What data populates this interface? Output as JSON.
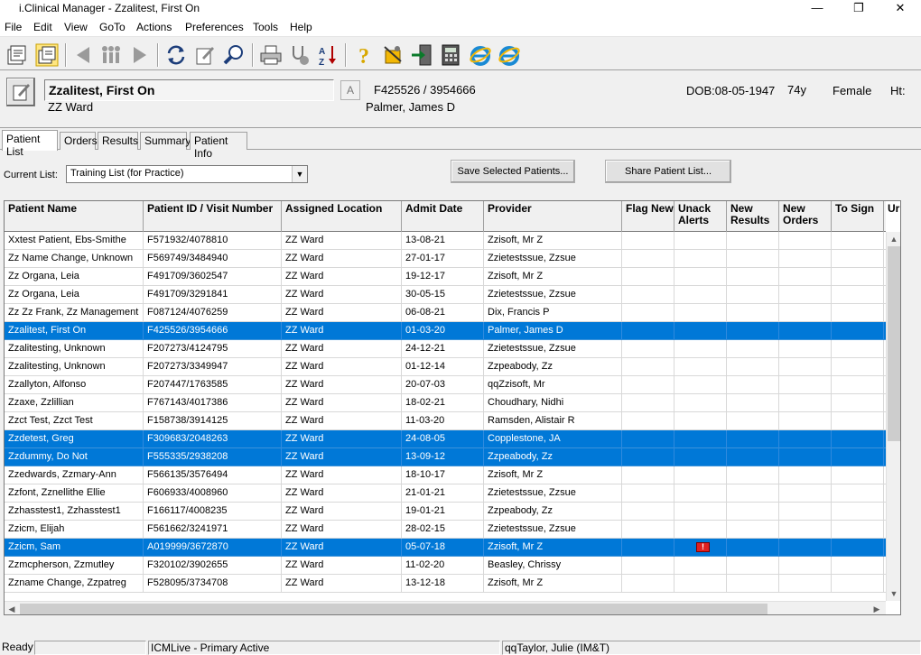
{
  "window": {
    "title": "i.Clinical Manager - Zzalitest, First On",
    "min_glyph": "—",
    "max_glyph": "❐",
    "close_glyph": "✕"
  },
  "menu": [
    "File",
    "Edit",
    "View",
    "GoTo",
    "Actions",
    "Preferences",
    "Tools",
    "Help"
  ],
  "toolbar_icons": [
    "patient-list-icon",
    "patient-list-edit-icon",
    "back-arrow-icon",
    "people-icon",
    "forward-arrow-icon",
    "refresh-icon",
    "notes-icon",
    "search-icon",
    "print-icon",
    "stethoscope-icon",
    "sort-az-icon",
    "help-icon",
    "tools-icon",
    "exit-icon",
    "calculator-icon",
    "internet-explorer-icon",
    "internet-explorer-icon-2"
  ],
  "patient": {
    "name": "Zzalitest, First On",
    "a_label": "A",
    "ids": "F425526 / 3954666",
    "ward": "ZZ Ward",
    "provider": "Palmer, James D",
    "dob": "DOB:08-05-1947",
    "age": "74y",
    "sex": "Female",
    "ht": "Ht:"
  },
  "tabs": [
    "Patient List",
    "Orders",
    "Results",
    "Summary",
    "Patient Info"
  ],
  "current_list": {
    "label": "Current List:",
    "value": "Training List (for Practice)"
  },
  "buttons": {
    "save_selected": "Save Selected Patients...",
    "share_list": "Share Patient List..."
  },
  "columns": [
    "Patient Name",
    "Patient ID / Visit Number",
    "Assigned Location",
    "Admit Date",
    "Provider",
    "Flag New",
    "Unack Alerts",
    "New Results",
    "New Orders",
    "To Sign",
    "Ur"
  ],
  "rows": [
    {
      "name": "Xxtest Patient, Ebs-Smithe",
      "id": "F571932/4078810",
      "loc": "ZZ Ward",
      "admit": "13-08-21",
      "provider": "Zzisoft, Mr Z",
      "selected": false
    },
    {
      "name": "Zz Name Change, Unknown",
      "id": "F569749/3484940",
      "loc": "ZZ Ward",
      "admit": "27-01-17",
      "provider": "Zzietestssue, Zzsue",
      "selected": false
    },
    {
      "name": "Zz Organa, Leia",
      "id": "F491709/3602547",
      "loc": "ZZ Ward",
      "admit": "19-12-17",
      "provider": "Zzisoft, Mr Z",
      "selected": false
    },
    {
      "name": "Zz Organa, Leia",
      "id": "F491709/3291841",
      "loc": "ZZ Ward",
      "admit": "30-05-15",
      "provider": "Zzietestssue, Zzsue",
      "selected": false
    },
    {
      "name": "Zz Zz Frank, Zz Management",
      "id": "F087124/4076259",
      "loc": "ZZ Ward",
      "admit": "06-08-21",
      "provider": "Dix, Francis P",
      "selected": false
    },
    {
      "name": "Zzalitest, First On",
      "id": "F425526/3954666",
      "loc": "ZZ Ward",
      "admit": "01-03-20",
      "provider": "Palmer, James D",
      "selected": true
    },
    {
      "name": "Zzalitesting, Unknown",
      "id": "F207273/4124795",
      "loc": "ZZ Ward",
      "admit": "24-12-21",
      "provider": "Zzietestssue, Zzsue",
      "selected": false
    },
    {
      "name": "Zzalitesting, Unknown",
      "id": "F207273/3349947",
      "loc": "ZZ Ward",
      "admit": "01-12-14",
      "provider": "Zzpeabody, Zz",
      "selected": false
    },
    {
      "name": "Zzallyton, Alfonso",
      "id": "F207447/1763585",
      "loc": "ZZ Ward",
      "admit": "20-07-03",
      "provider": "qqZzisoft, Mr",
      "selected": false
    },
    {
      "name": "Zzaxe, Zzlillian",
      "id": "F767143/4017386",
      "loc": "ZZ Ward",
      "admit": "18-02-21",
      "provider": "Choudhary, Nidhi",
      "selected": false
    },
    {
      "name": "Zzct Test, Zzct Test",
      "id": "F158738/3914125",
      "loc": "ZZ Ward",
      "admit": "11-03-20",
      "provider": "Ramsden, Alistair R",
      "selected": false
    },
    {
      "name": "Zzdetest, Greg",
      "id": "F309683/2048263",
      "loc": "ZZ Ward",
      "admit": "24-08-05",
      "provider": "Copplestone, JA",
      "selected": true
    },
    {
      "name": "Zzdummy, Do Not",
      "id": "F555335/2938208",
      "loc": "ZZ Ward",
      "admit": "13-09-12",
      "provider": "Zzpeabody, Zz",
      "selected": true
    },
    {
      "name": "Zzedwards, Zzmary-Ann",
      "id": "F566135/3576494",
      "loc": "ZZ Ward",
      "admit": "18-10-17",
      "provider": "Zzisoft, Mr Z",
      "selected": false
    },
    {
      "name": "Zzfont, Zznellithe Ellie",
      "id": "F606933/4008960",
      "loc": "ZZ Ward",
      "admit": "21-01-21",
      "provider": "Zzietestssue, Zzsue",
      "selected": false
    },
    {
      "name": "Zzhasstest1, Zzhasstest1",
      "id": "F166117/4008235",
      "loc": "ZZ Ward",
      "admit": "19-01-21",
      "provider": "Zzpeabody, Zz",
      "selected": false
    },
    {
      "name": "Zzicm, Elijah",
      "id": "F561662/3241971",
      "loc": "ZZ Ward",
      "admit": "28-02-15",
      "provider": "Zzietestssue, Zzsue",
      "selected": false
    },
    {
      "name": "Zzicm, Sam",
      "id": "A019999/3672870",
      "loc": "ZZ Ward",
      "admit": "05-07-18",
      "provider": "Zzisoft, Mr Z",
      "selected": true,
      "unack_alert": true
    },
    {
      "name": "Zzmcpherson, Zzmutley",
      "id": "F320102/3902655",
      "loc": "ZZ Ward",
      "admit": "11-02-20",
      "provider": "Beasley, Chrissy",
      "selected": false
    },
    {
      "name": "Zzname Change, Zzpatreg",
      "id": "F528095/3734708",
      "loc": "ZZ Ward",
      "admit": "13-12-18",
      "provider": "Zzisoft, Mr Z",
      "selected": false
    }
  ],
  "alert_glyph": "!",
  "status": {
    "ready": "Ready",
    "system": "ICMLive - Primary Active",
    "user": "qqTaylor, Julie (IM&T)"
  },
  "colors": {
    "selection": "#0078d7",
    "alert": "#e02020"
  }
}
